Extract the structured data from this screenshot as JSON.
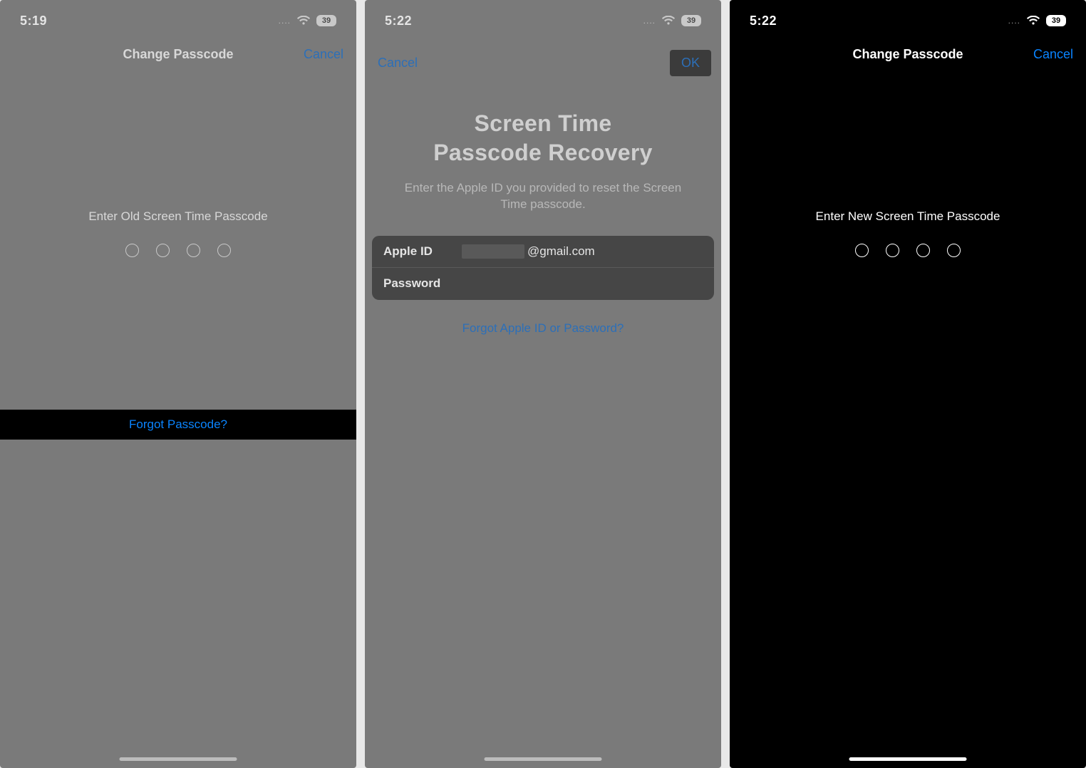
{
  "status": {
    "battery_text": "39"
  },
  "screen1": {
    "time": "5:19",
    "title": "Change Passcode",
    "cancel": "Cancel",
    "prompt": "Enter Old Screen Time Passcode",
    "forgot": "Forgot Passcode?"
  },
  "screen2": {
    "time": "5:22",
    "cancel": "Cancel",
    "ok": "OK",
    "title_line1": "Screen Time",
    "title_line2": "Passcode Recovery",
    "subtitle": "Enter the Apple ID you provided to reset the Screen Time passcode.",
    "appleid_label": "Apple ID",
    "appleid_value_suffix": "@gmail.com",
    "password_label": "Password",
    "forgot": "Forgot Apple ID or Password?"
  },
  "screen3": {
    "time": "5:22",
    "title": "Change Passcode",
    "cancel": "Cancel",
    "prompt": "Enter New Screen Time Passcode"
  }
}
